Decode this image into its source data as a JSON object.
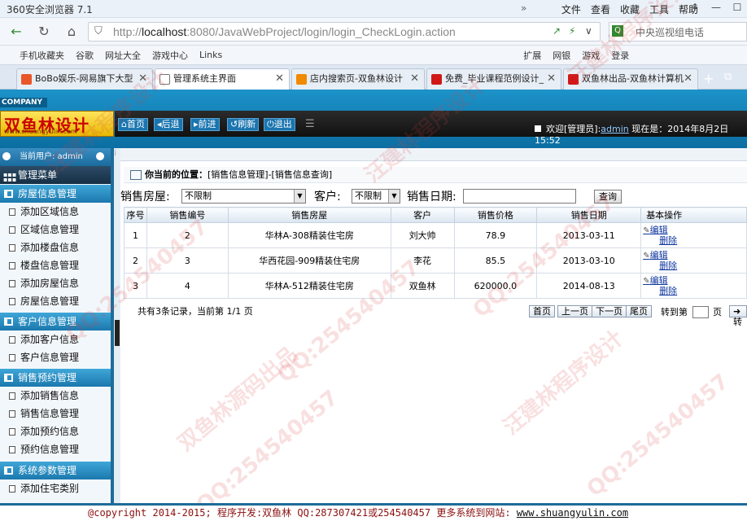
{
  "browser": {
    "title": "360安全浏览器 7.1",
    "menu": [
      "文件",
      "查看",
      "收藏",
      "工具",
      "帮助"
    ],
    "url_plain": "http://",
    "url_host": "localhost",
    "url_rest": ":8080/JavaWebProject/login/login_CheckLogin.action",
    "search_text": "中央巡视组电话",
    "bookmarks": [
      "手机收藏夹",
      "谷歌",
      "网址大全",
      "游戏中心",
      "Links",
      "扩展",
      "网银",
      "游戏",
      "登录"
    ],
    "tabs": [
      {
        "label": "BoBo娱乐-网易旗下大型",
        "active": false,
        "color": "#e8562a"
      },
      {
        "label": "管理系统主界面",
        "active": true,
        "color": "#ffffff"
      },
      {
        "label": "店内搜索页-双鱼林设计",
        "active": false,
        "color": "#f08a00"
      },
      {
        "label": "免费_毕业课程范例设计_",
        "active": false,
        "color": "#d01818"
      },
      {
        "label": "双鱼林出品-双鱼林计算机",
        "active": false,
        "color": "#d01818"
      }
    ]
  },
  "header": {
    "company": "COMPANY",
    "logo_text": "双鱼林设计",
    "logo_sub": "www.shuangyulin.com",
    "nav": [
      "首页",
      "后退",
      "前进",
      "刷新",
      "退出"
    ],
    "welcome_prefix": "欢迎[管理员]:",
    "welcome_user": "admin",
    "now_label": "现在是：2014年8月2日 15:52"
  },
  "sidebar": {
    "current_user": "当前用户: admin",
    "menu_title": "管理菜单",
    "groups": [
      {
        "title": "房屋信息管理",
        "items": [
          "添加区域信息",
          "区域信息管理",
          "添加楼盘信息",
          "楼盘信息管理",
          "添加房屋信息",
          "房屋信息管理"
        ]
      },
      {
        "title": "客户信息管理",
        "items": [
          "添加客户信息",
          "客户信息管理"
        ]
      },
      {
        "title": "销售预约管理",
        "items": [
          "添加销售信息",
          "销售信息管理",
          "添加预约信息",
          "预约信息管理"
        ]
      },
      {
        "title": "系统参数管理",
        "items": [
          "添加住宅类别"
        ]
      }
    ]
  },
  "main": {
    "location_label": "你当前的位置：",
    "location_path": "[销售信息管理]-[销售信息查询]",
    "filters": {
      "house_label": "销售房屋:",
      "house_value": "不限制",
      "customer_label": "客户:",
      "customer_value": "不限制",
      "date_label": "销售日期:",
      "date_value": "",
      "query_button": "查询"
    },
    "columns": [
      "序号",
      "销售编号",
      "销售房屋",
      "客户",
      "销售价格",
      "销售日期",
      "基本操作"
    ],
    "rows": [
      {
        "idx": "1",
        "code": "2",
        "house": "华林A-308精装住宅房",
        "customer": "刘大帅",
        "price": "78.9",
        "date": "2013-03-11",
        "edit": "编辑",
        "del": "删除"
      },
      {
        "idx": "2",
        "code": "3",
        "house": "华西花园-909精装住宅房",
        "customer": "李花",
        "price": "85.5",
        "date": "2013-03-10",
        "edit": "编辑",
        "del": "删除"
      },
      {
        "idx": "3",
        "code": "4",
        "house": "华林A-512精装住宅房",
        "customer": "双鱼林",
        "price": "620000.0",
        "date": "2014-08-13",
        "edit": "编辑",
        "del": "删除"
      }
    ],
    "pager": {
      "summary": "共有3条记录，当前第 1/1 页",
      "first": "首页",
      "prev": "上一页",
      "next": "下一页",
      "last": "尾页",
      "goto_label": "转到第",
      "page_unit": "页",
      "goto_button": "转"
    }
  },
  "footer": {
    "text": "@copyright 2014-2015; 程序开发:双鱼林  QQ:287307421或254540457  更多系统到网站:",
    "url": "www.shuangyulin.com"
  },
  "watermarks": [
    "QQ:254540457",
    "双鱼林源码出品",
    "汪建林程序设计"
  ]
}
